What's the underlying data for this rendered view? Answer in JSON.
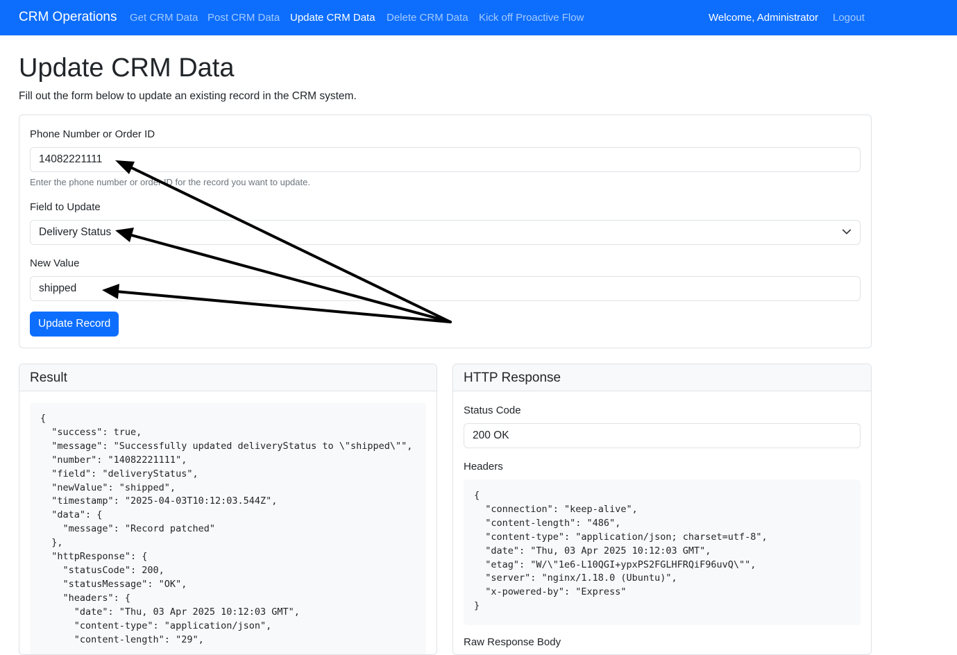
{
  "nav": {
    "brand": "CRM Operations",
    "links": [
      {
        "label": "Get CRM Data"
      },
      {
        "label": "Post CRM Data"
      },
      {
        "label": "Update CRM Data"
      },
      {
        "label": "Delete CRM Data"
      },
      {
        "label": "Kick off Proactive Flow"
      }
    ],
    "welcome": "Welcome, Administrator",
    "logout": "Logout"
  },
  "page": {
    "title": "Update CRM Data",
    "lead": "Fill out the form below to update an existing record in the CRM system."
  },
  "form": {
    "id_label": "Phone Number or Order ID",
    "id_value": "14082221111",
    "id_help": "Enter the phone number or order ID for the record you want to update.",
    "field_label": "Field to Update",
    "field_value": "Delivery Status",
    "value_label": "New Value",
    "value_value": "shipped",
    "submit_label": "Update Record"
  },
  "result": {
    "title": "Result",
    "json": "{\n  \"success\": true,\n  \"message\": \"Successfully updated deliveryStatus to \\\"shipped\\\"\",\n  \"number\": \"14082221111\",\n  \"field\": \"deliveryStatus\",\n  \"newValue\": \"shipped\",\n  \"timestamp\": \"2025-04-03T10:12:03.544Z\",\n  \"data\": {\n    \"message\": \"Record patched\"\n  },\n  \"httpResponse\": {\n    \"statusCode\": 200,\n    \"statusMessage\": \"OK\",\n    \"headers\": {\n      \"date\": \"Thu, 03 Apr 2025 10:12:03 GMT\",\n      \"content-type\": \"application/json\",\n      \"content-length\": \"29\","
  },
  "http": {
    "title": "HTTP Response",
    "status_label": "Status Code",
    "status_value": "200 OK",
    "headers_label": "Headers",
    "headers_json": "{\n  \"connection\": \"keep-alive\",\n  \"content-length\": \"486\",\n  \"content-type\": \"application/json; charset=utf-8\",\n  \"date\": \"Thu, 03 Apr 2025 10:12:03 GMT\",\n  \"etag\": \"W/\\\"1e6-L10QGI+ypxPS2FGLHFRQiF96uvQ\\\"\",\n  \"server\": \"nginx/1.18.0 (Ubuntu)\",\n  \"x-powered-by\": \"Express\"\n}",
    "raw_body_label": "Raw Response Body"
  },
  "colors": {
    "navbar": "#0d6efd",
    "button": "#0d6efd",
    "annotation_arrows": "#000000"
  }
}
